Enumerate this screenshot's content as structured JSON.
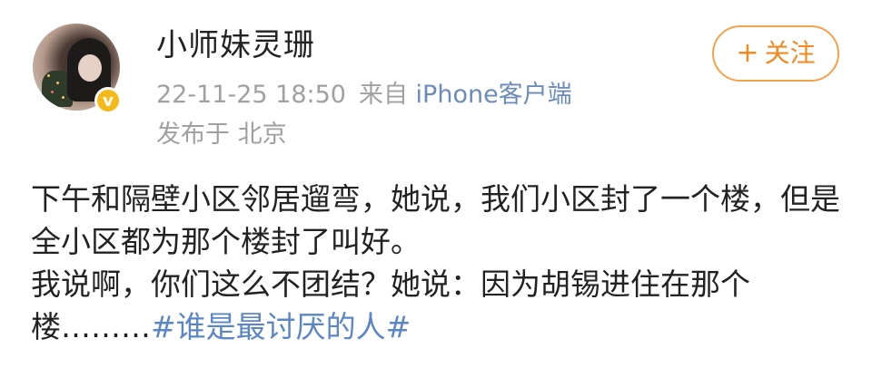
{
  "post": {
    "author": "小师妹灵珊",
    "timestamp": "22-11-25 18:50",
    "source_prefix": "来自",
    "source_device": "iPhone客户端",
    "location": "发布于 北京",
    "follow_button": {
      "plus": "+",
      "label": "关注"
    },
    "verified_badge": "v",
    "paragraph1": "下午和隔壁小区邻居遛弯，她说，我们小区封了一个楼，但是全小区都为那个楼封了叫好。",
    "paragraph2_text": "我说啊，你们这么不团结？她说：因为胡锡进住在那个楼………",
    "hashtag": "#谁是最讨厌的人#"
  },
  "icons": {
    "avatar": "user-avatar-photo",
    "verified": "verified-badge-icon"
  },
  "colors": {
    "accent_orange": "#f08a1e",
    "link_blue": "#5b86c4",
    "meta_gray": "#a0a0a0",
    "verified_yellow": "#f5b91a"
  }
}
